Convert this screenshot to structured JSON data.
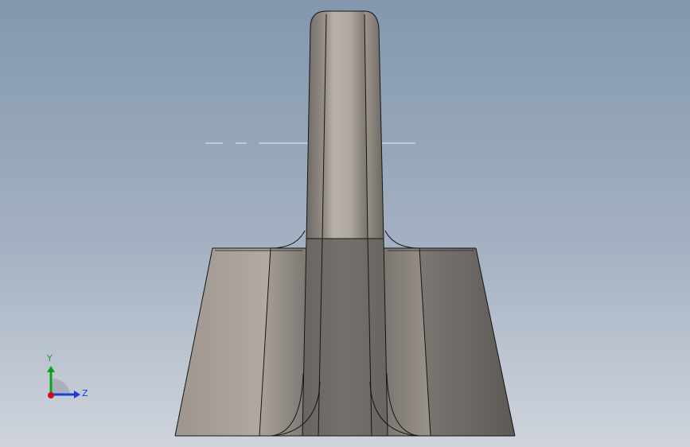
{
  "viewport": {
    "background_top": "#8297ae",
    "background_bottom": "#cfd4dc"
  },
  "model": {
    "face_colors": {
      "light": "#b3aca4",
      "mid": "#9b948c",
      "dark": "#6f6a65",
      "edge": "#1a1a1a"
    }
  },
  "triad": {
    "y_label": "Y",
    "z_label": "Z",
    "y_color": "#0aa31a",
    "z_color": "#1a3fd6",
    "x_color": "#d01010"
  }
}
